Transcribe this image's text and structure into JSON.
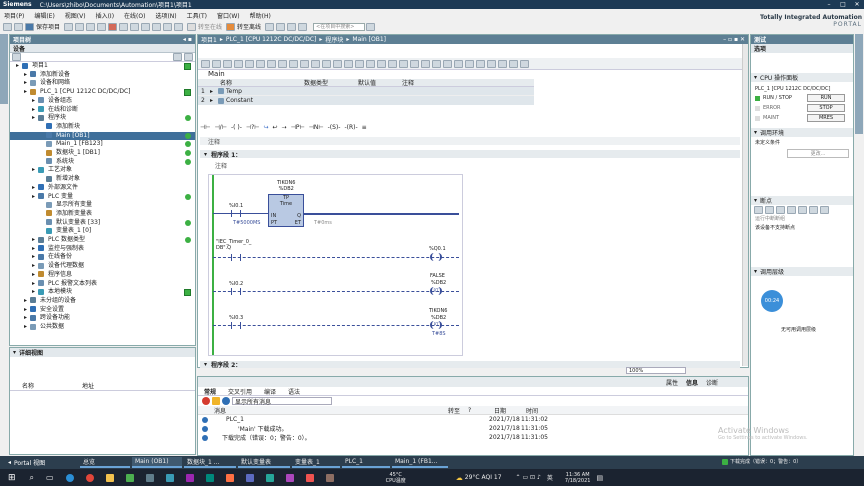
{
  "app": {
    "vendor": "Siemens",
    "title": "C:\\Users\\zhibo\\Documents\\Automation\\项目1\\项目1",
    "brand_line1": "Totally Integrated Automation",
    "brand_line2": "PORTAL"
  },
  "menu": [
    "项目(P)",
    "编辑(E)",
    "视图(V)",
    "插入(I)",
    "在线(O)",
    "选项(N)",
    "工具(T)",
    "窗口(W)",
    "帮助(H)"
  ],
  "toolbar": {
    "save_label": "保存项目",
    "go_online": "转至在线",
    "go_offline": "转至离线",
    "search_placeholder": "<在项目中搜索>"
  },
  "project_tree": {
    "title": "项目树",
    "devices_tab": "设备",
    "items": [
      {
        "label": "项目1",
        "indent": 0,
        "status": "check"
      },
      {
        "label": "添加新设备",
        "indent": 1
      },
      {
        "label": "设备和网络",
        "indent": 1
      },
      {
        "label": "PLC_1 [CPU 1212C DC/DC/DC]",
        "indent": 1,
        "status": "check"
      },
      {
        "label": "设备组态",
        "indent": 2
      },
      {
        "label": "在线和诊断",
        "indent": 2
      },
      {
        "label": "程序块",
        "indent": 2,
        "status": "dot"
      },
      {
        "label": "添加新块",
        "indent": 3
      },
      {
        "label": "Main [OB1]",
        "indent": 3,
        "status": "dot",
        "selected": true
      },
      {
        "label": "Main_1 [FB123]",
        "indent": 3,
        "status": "dot"
      },
      {
        "label": "数据块_1 [DB1]",
        "indent": 3,
        "status": "dot"
      },
      {
        "label": "系统块",
        "indent": 3,
        "status": "dot"
      },
      {
        "label": "工艺对象",
        "indent": 2
      },
      {
        "label": "新增对象",
        "indent": 3
      },
      {
        "label": "外部源文件",
        "indent": 2
      },
      {
        "label": "PLC 变量",
        "indent": 2,
        "status": "dot"
      },
      {
        "label": "显示所有变量",
        "indent": 3
      },
      {
        "label": "添加新变量表",
        "indent": 3
      },
      {
        "label": "默认变量表 [33]",
        "indent": 3,
        "status": "dot"
      },
      {
        "label": "变量表_1 [0]",
        "indent": 3
      },
      {
        "label": "PLC 数据类型",
        "indent": 2,
        "status": "dot"
      },
      {
        "label": "监控与强制表",
        "indent": 2
      },
      {
        "label": "在线备份",
        "indent": 2
      },
      {
        "label": "设备代理数据",
        "indent": 2
      },
      {
        "label": "程序信息",
        "indent": 2
      },
      {
        "label": "PLC 报警文本列表",
        "indent": 2
      },
      {
        "label": "本地模块",
        "indent": 2,
        "status": "check"
      },
      {
        "label": "未分组的设备",
        "indent": 1
      },
      {
        "label": "安全设置",
        "indent": 1
      },
      {
        "label": "跨设备功能",
        "indent": 1
      },
      {
        "label": "公共数据",
        "indent": 1
      }
    ]
  },
  "details_view": {
    "title": "详细视图",
    "col_name": "名称",
    "col_address": "地址"
  },
  "editor": {
    "breadcrumb": [
      "项目1",
      "PLC_1 [CPU 1212C DC/DC/DC]",
      "程序块",
      "Main [OB1]"
    ],
    "block_name": "Main",
    "interface_headers": [
      "名称",
      "数据类型",
      "默认值",
      "注释"
    ],
    "interface_rows": [
      {
        "num": "1",
        "name": "Temp"
      },
      {
        "num": "2",
        "name": "Constant"
      }
    ],
    "block_title": "注释",
    "network_title": "程序段 1：",
    "network_comment": "注释",
    "next_network": "程序段 2：",
    "zoom": "100%"
  },
  "ladder": {
    "timer_instance": "TIKON6\n%DB2",
    "timer_type": "TP",
    "timer_time": "Time",
    "timer_in": "IN",
    "timer_q": "Q",
    "timer_pt": "PT",
    "timer_et": "ET",
    "pt_value": "T#5000MS",
    "et_value": "T#0ms",
    "i01": "%I0.1",
    "timer_q_ref": "\"IEC_Timer_0_\nDB\".Q",
    "q01": "%Q0.1",
    "false_label": "FALSE",
    "db2_1": "%DB2",
    "rt": "RT",
    "i02": "%I0.2",
    "i03": "%I0.3",
    "tikon6": "TIKON6",
    "db2_2": "%DB2",
    "pt_coil": "PT",
    "t8s": "T#8S"
  },
  "inspector": {
    "tabs": [
      "常规",
      "交叉引用",
      "编译",
      "语法"
    ],
    "right_tabs": [
      "属性",
      "信息",
      "诊断"
    ],
    "filter": "显示所有消息",
    "headers": [
      "消息",
      "转至",
      "?",
      "日期",
      "时间"
    ],
    "rows": [
      {
        "msg": "PLC_1",
        "date": "2021/7/18",
        "time": "11:31:02"
      },
      {
        "msg": "'Main' 下载成功。",
        "date": "2021/7/18",
        "time": "11:31:05"
      },
      {
        "msg": "下载完成（错误：0；警告：0）。",
        "date": "2021/7/18",
        "time": "11:31:05"
      }
    ]
  },
  "right_panel": {
    "title": "测试",
    "options": "选项",
    "cpu_panel": "CPU 操作面板",
    "cpu_name": "PLC_1 [CPU 1212C DC/DC/DC]",
    "run_stop": "RUN / STOP",
    "error": "ERROR",
    "maint": "MAINT",
    "btn_run": "RUN",
    "btn_stop": "STOP",
    "btn_mres": "MRES",
    "call_env": "调用环境",
    "call_env_value": "未定义条件",
    "change_btn": "更改...",
    "breakpoints": "断点",
    "breakpoint_hint": "运行中断断组",
    "breakpoint_status": "该设备不支持断点",
    "call_hierarchy": "调用层级",
    "badge": "00:24",
    "no_call": "无可用调用层级"
  },
  "statusbar": {
    "portal_view": "Portal 视图",
    "tasks": [
      "总览",
      "Main (OB1)",
      "数据块_1 ...",
      "默认变量表",
      "变量表_1",
      "PLC_1",
      "Main_1 (FB1..."
    ],
    "status_msg": "下载完成（错误：0；警告：0）",
    "watermark1": "Activate Windows",
    "watermark2": "Go to Settings to activate Windows."
  },
  "windows_taskbar": {
    "cpu_temp": "45°C",
    "cpu_label": "CPU温度",
    "weather": "29°C AQI 17",
    "lang": "英",
    "time": "11:36 AM",
    "date": "7/18/2021"
  }
}
